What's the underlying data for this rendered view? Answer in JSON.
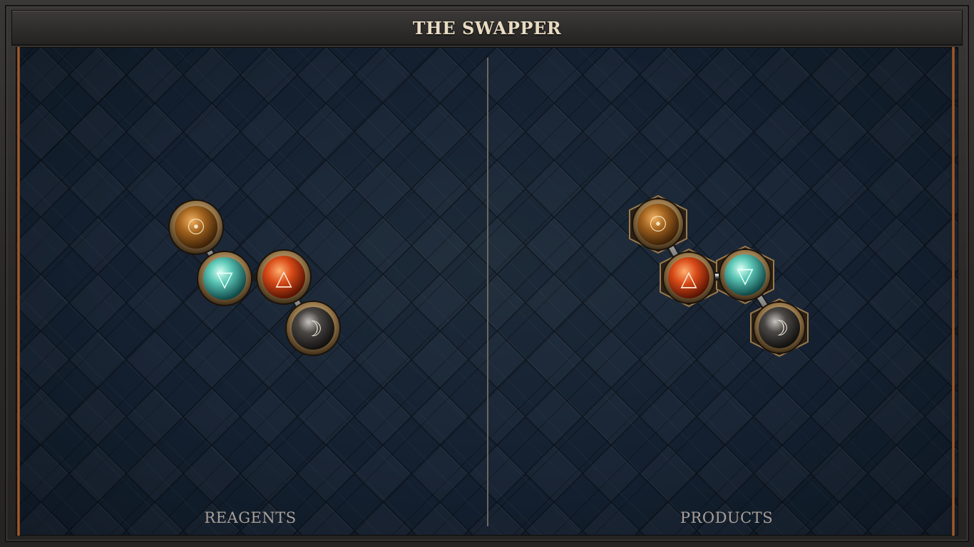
{
  "title": "THE SWAPPER",
  "panels": {
    "left_label": "REAGENTS",
    "right_label": "PRODUCTS"
  },
  "atoms": {
    "salt": {
      "symbol": "☉",
      "color": "#a0621e",
      "name": "salt"
    },
    "water": {
      "symbol": "▽",
      "color": "#4fb8aa",
      "name": "water"
    },
    "fire": {
      "symbol": "△",
      "color": "#d84a18",
      "name": "fire"
    },
    "moon": {
      "symbol": "☽",
      "color": "#3a3836",
      "name": "moon"
    }
  },
  "colors": {
    "accent_copper": "#b0652d",
    "title_text": "#e9dcc3",
    "label_text": "#a8a099",
    "board_bg": "#142030"
  }
}
